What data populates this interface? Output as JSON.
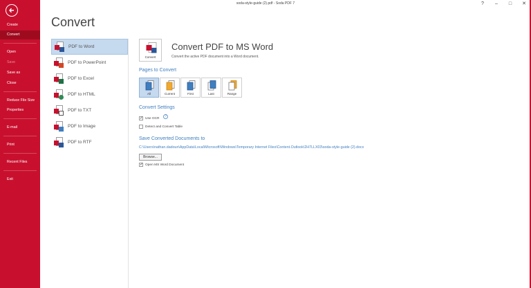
{
  "window": {
    "title": "soda-style-guide (2).pdf - Soda PDF 7",
    "controls": [
      "?",
      "–",
      "□",
      "✕"
    ]
  },
  "sidebar": {
    "items": [
      {
        "label": "Create"
      },
      {
        "label": "Convert",
        "selected": true
      },
      {
        "label": "Open"
      },
      {
        "label": "Save",
        "disabled": true
      },
      {
        "label": "Save as"
      },
      {
        "label": "Close"
      },
      {
        "label": "Reduce File Size"
      },
      {
        "label": "Properties"
      },
      {
        "label": "E-mail"
      },
      {
        "label": "Print"
      },
      {
        "label": "Recent Files"
      },
      {
        "label": "Exit"
      }
    ],
    "accent": "#c8102e"
  },
  "page": {
    "title": "Convert"
  },
  "options": [
    {
      "label": "PDF to Word",
      "icon": "word-icon",
      "color": "#2b5797",
      "selected": true
    },
    {
      "label": "PDF to PowerPoint",
      "icon": "powerpoint-icon",
      "color": "#d24726"
    },
    {
      "label": "PDF to Excel",
      "icon": "excel-icon",
      "color": "#1e7145"
    },
    {
      "label": "PDF to HTML",
      "icon": "html-icon",
      "color": "#2e8b57"
    },
    {
      "label": "PDF to TXT",
      "icon": "txt-icon",
      "color": "#555555"
    },
    {
      "label": "PDF to Image",
      "icon": "image-icon",
      "color": "#3f7fbf"
    },
    {
      "label": "PDF to RTF",
      "icon": "rtf-icon",
      "color": "#2b5797"
    }
  ],
  "main": {
    "convert_label": "Convert",
    "heading": "Convert PDF to MS Word",
    "description": "Convert the active PDF document into a Word document.",
    "pages_heading": "Pages to Convert",
    "pages": [
      {
        "label": "All",
        "selected": true
      },
      {
        "label": "Current"
      },
      {
        "label": "First"
      },
      {
        "label": "Last"
      },
      {
        "label": "Range"
      }
    ],
    "settings_heading": "Convert Settings",
    "use_ocr_label": "Use OCR",
    "use_ocr_checked": true,
    "help_glyph": "?",
    "detect_tables_label": "Detect and Convert Table",
    "detect_tables_checked": false,
    "save_heading": "Save Converted Documents to",
    "save_path": "C:\\Users\\nathan.dadoun\\AppData\\Local\\Microsoft\\Windows\\Temporary Internet Files\\Content.Outlook\\2H7LLX03\\soda-style-guide (2).docx",
    "browse_label": "Browse...",
    "open_label": "Open MS Word Document",
    "open_checked": true
  }
}
